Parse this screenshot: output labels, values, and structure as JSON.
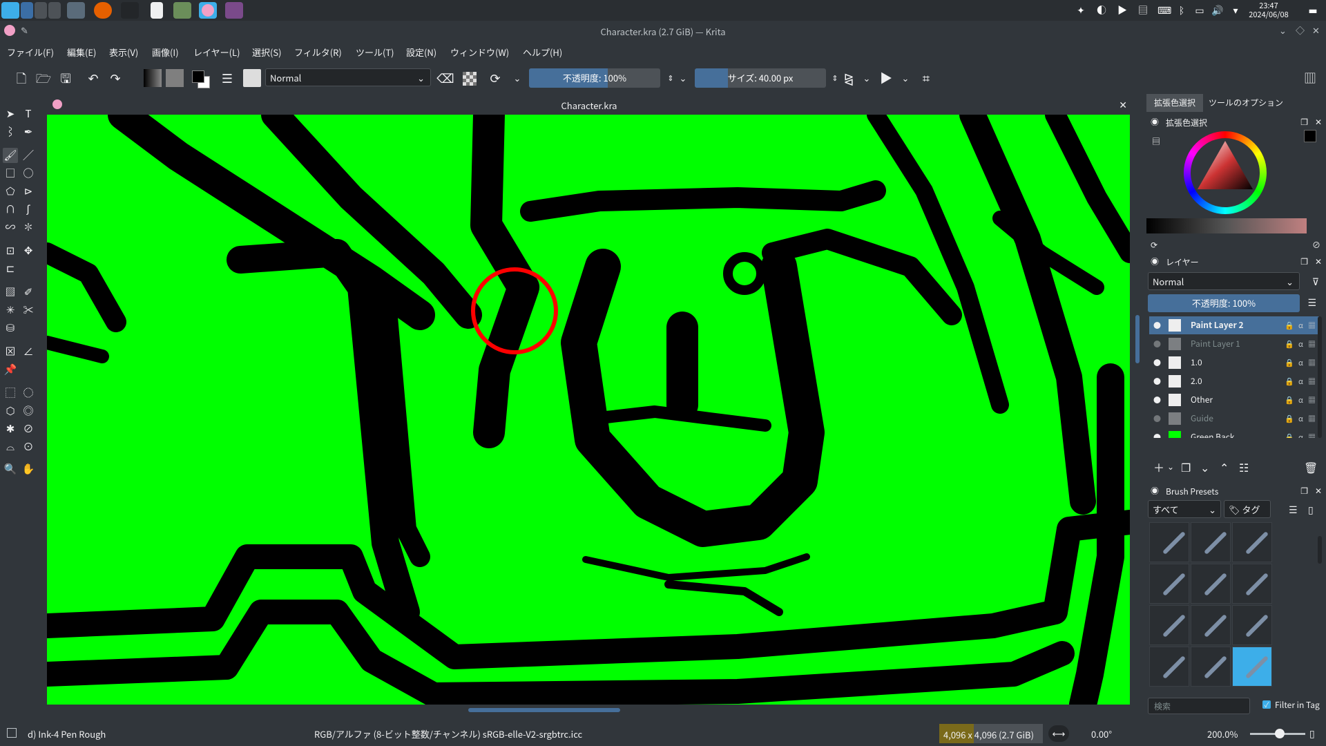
{
  "taskbar": {
    "clock_time": "23:47",
    "clock_date": "2024/06/08"
  },
  "window": {
    "title": "Character.kra (2.7 GiB) — Krita"
  },
  "menu": [
    "ファイル(F)",
    "編集(E)",
    "表示(V)",
    "画像(I)",
    "レイヤー(L)",
    "選択(S)",
    "フィルタ(R)",
    "ツール(T)",
    "設定(N)",
    "ウィンドウ(W)",
    "ヘルプ(H)"
  ],
  "toolbar": {
    "blend_mode": "Normal",
    "opacity_label": "不透明度: 100%",
    "opacity_fraction": 0.6,
    "size_label": "サイズ: 40.00 px",
    "size_fraction": 0.25
  },
  "canvas": {
    "tab_title": "Character.kra",
    "background_color": "#00ff00",
    "annotation_circle_color": "#ff0000"
  },
  "docker": {
    "tabs": [
      "拡張色選択",
      "ツールのオプション"
    ],
    "color_selector_title": "拡張色選択",
    "layers_title": "レイヤー",
    "layers_blend": "Normal",
    "layers_opacity": "不透明度: 100%",
    "layers": [
      {
        "name": "Paint Layer 2",
        "visible": true,
        "selected": true
      },
      {
        "name": "Paint Layer 1",
        "visible": false,
        "selected": false
      },
      {
        "name": "1.0",
        "visible": true,
        "selected": false
      },
      {
        "name": "2.0",
        "visible": true,
        "selected": false
      },
      {
        "name": "Other",
        "visible": true,
        "selected": false
      },
      {
        "name": "Guide",
        "visible": false,
        "selected": false
      },
      {
        "name": "Green Back",
        "visible": true,
        "selected": false
      }
    ],
    "brush_presets_title": "Brush Presets",
    "brush_filter": "すべて",
    "brush_tag": "タグ",
    "search_placeholder": "検索",
    "filter_in_tag": "Filter in Tag"
  },
  "status": {
    "brush_name": "d) Ink-4 Pen Rough",
    "color_space": "RGB/アルファ (8-ビット整数/チャンネル)  sRGB-elle-V2-srgbtrc.icc",
    "image_size": "4,096 x 4,096 (2.7 GiB)",
    "rotation": "0.00°",
    "zoom": "200.0%"
  }
}
